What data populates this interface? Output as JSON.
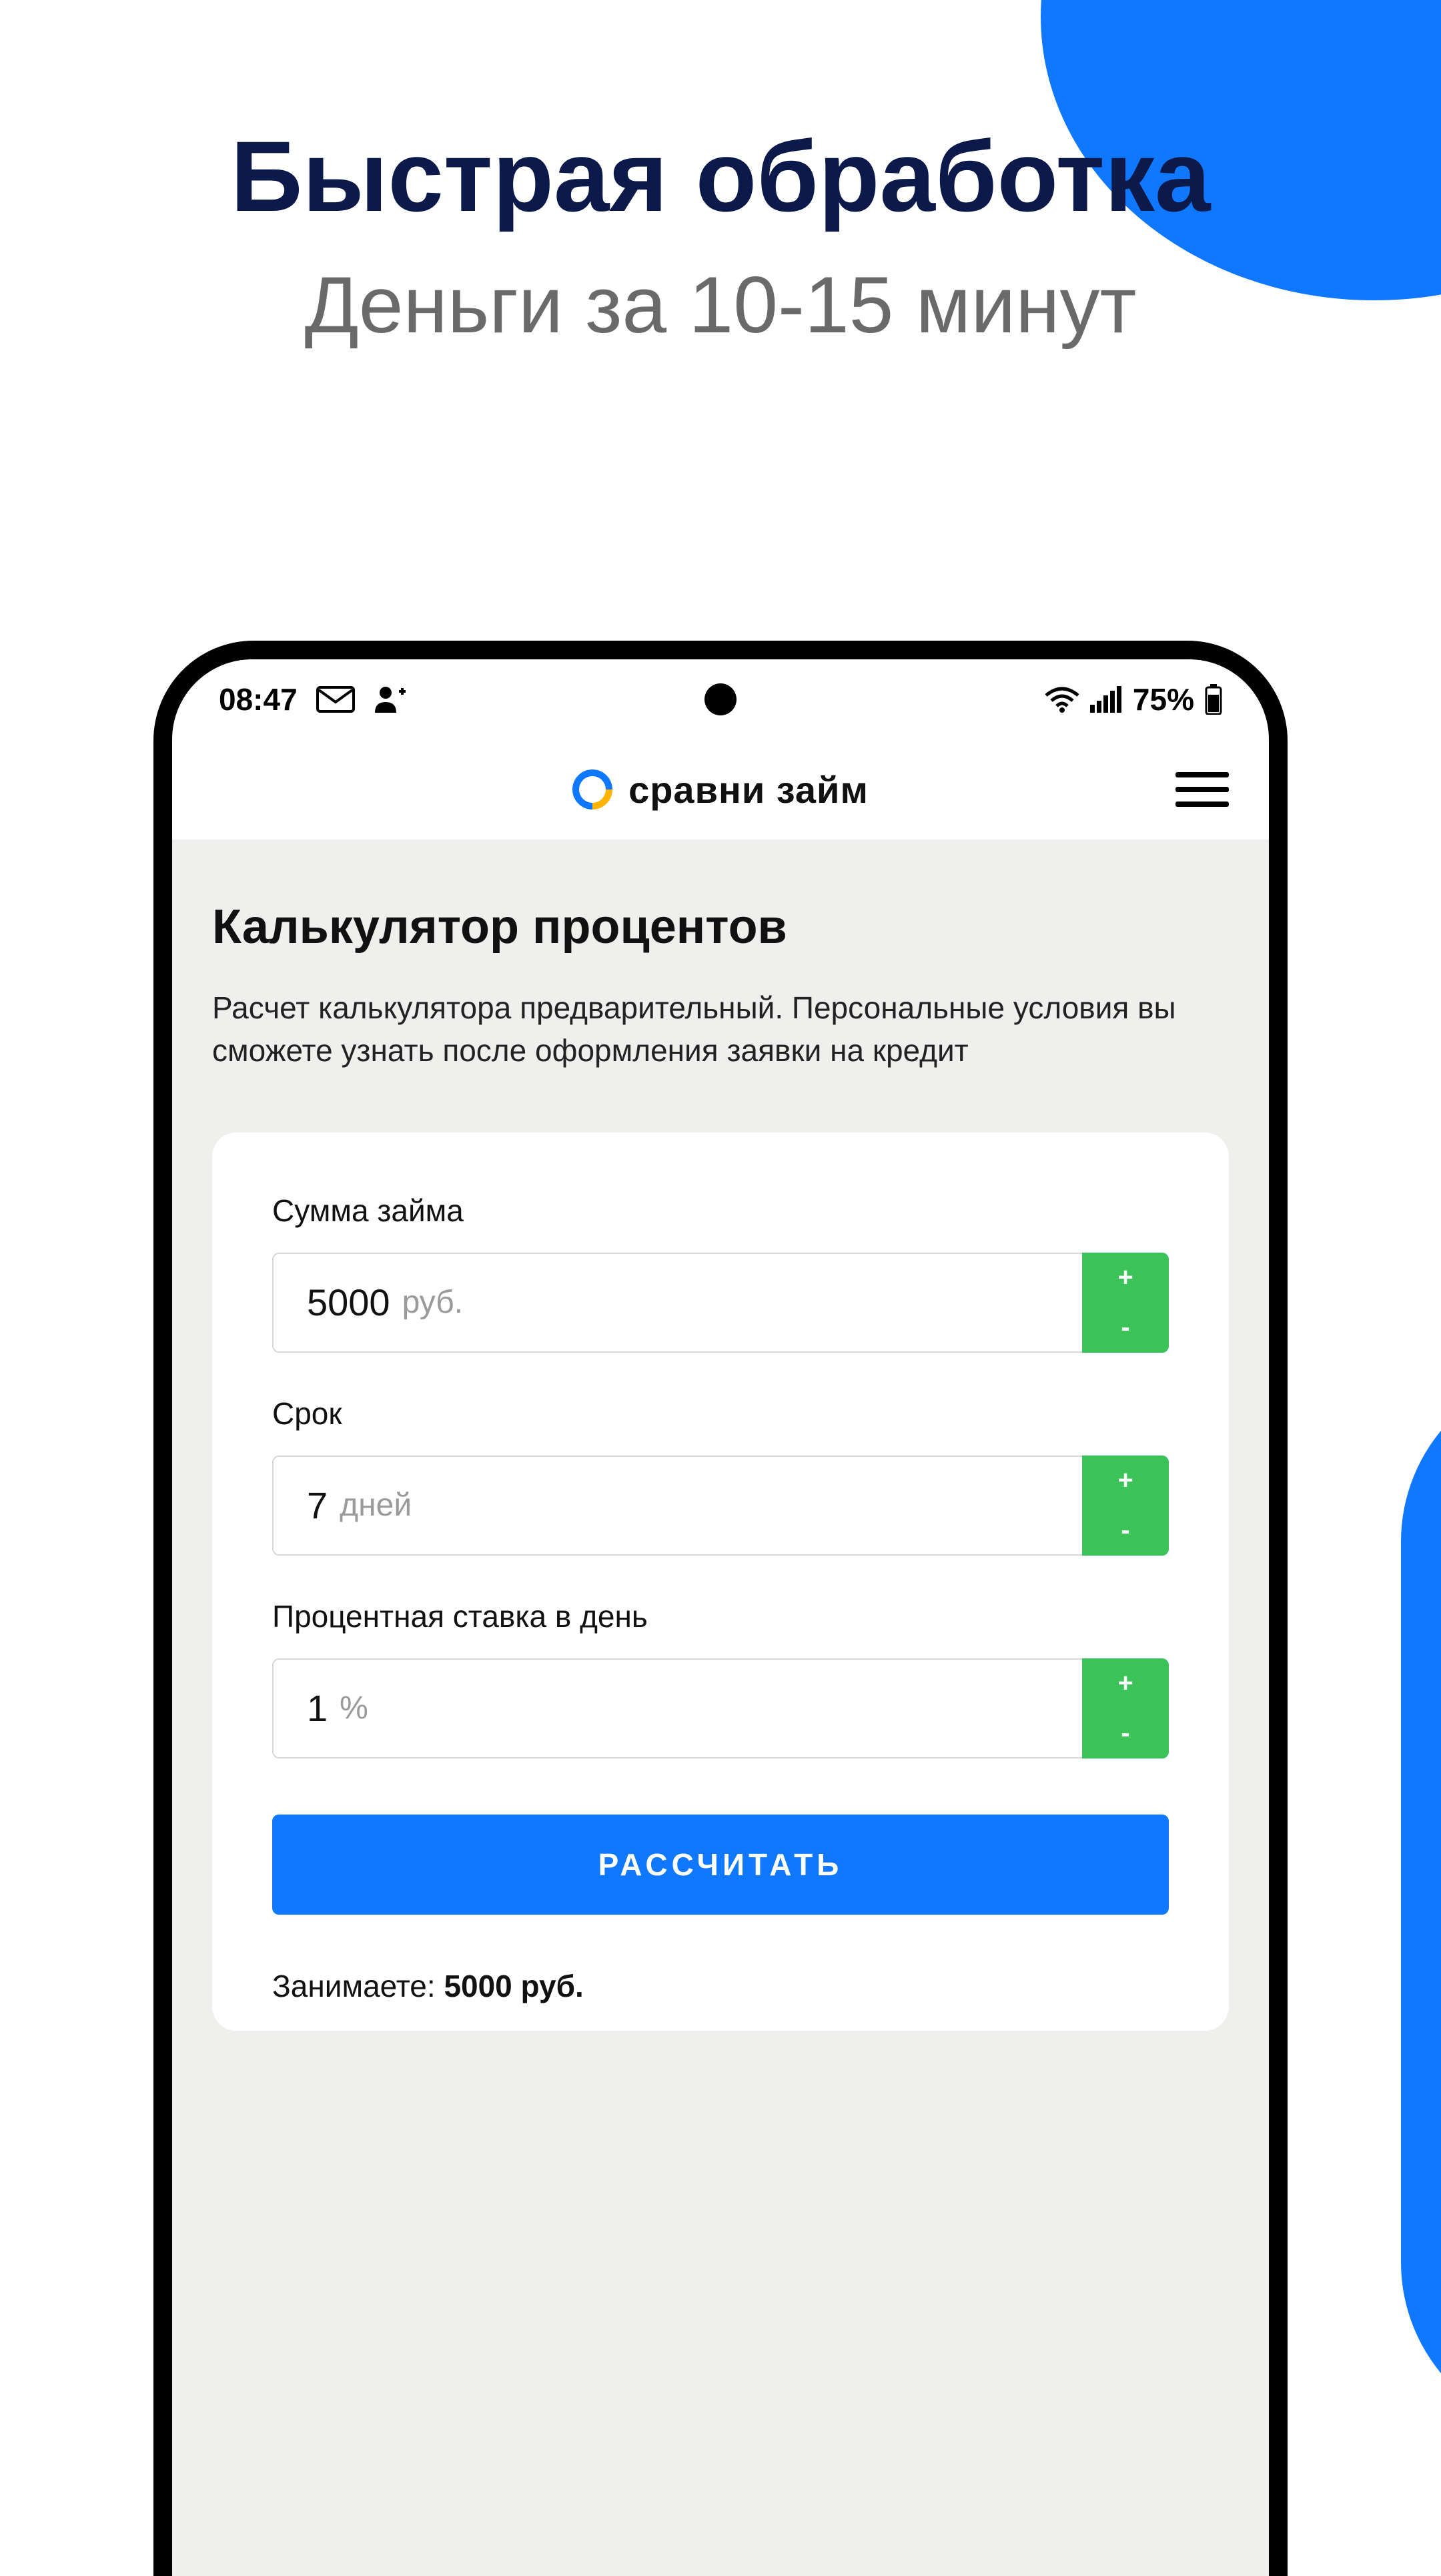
{
  "promo": {
    "headline": "Быстрая обработка",
    "subline": "Деньги за 10-15 минут"
  },
  "statusbar": {
    "time": "08:47",
    "battery": "75%"
  },
  "header": {
    "brand": "сравни займ"
  },
  "page": {
    "title": "Калькулятор процентов",
    "description": "Расчет калькулятора предварительный. Персональные условия вы сможете узнать после оформления заявки на кредит"
  },
  "form": {
    "amount": {
      "label": "Сумма займа",
      "value": "5000",
      "unit": "руб."
    },
    "term": {
      "label": "Срок",
      "value": "7",
      "unit": "дней"
    },
    "rate": {
      "label": "Процентная ставка в день",
      "value": "1",
      "unit": "%"
    },
    "submit": "РАССЧИТАТЬ"
  },
  "summary": {
    "label": "Занимаете:",
    "value": "5000 руб."
  }
}
